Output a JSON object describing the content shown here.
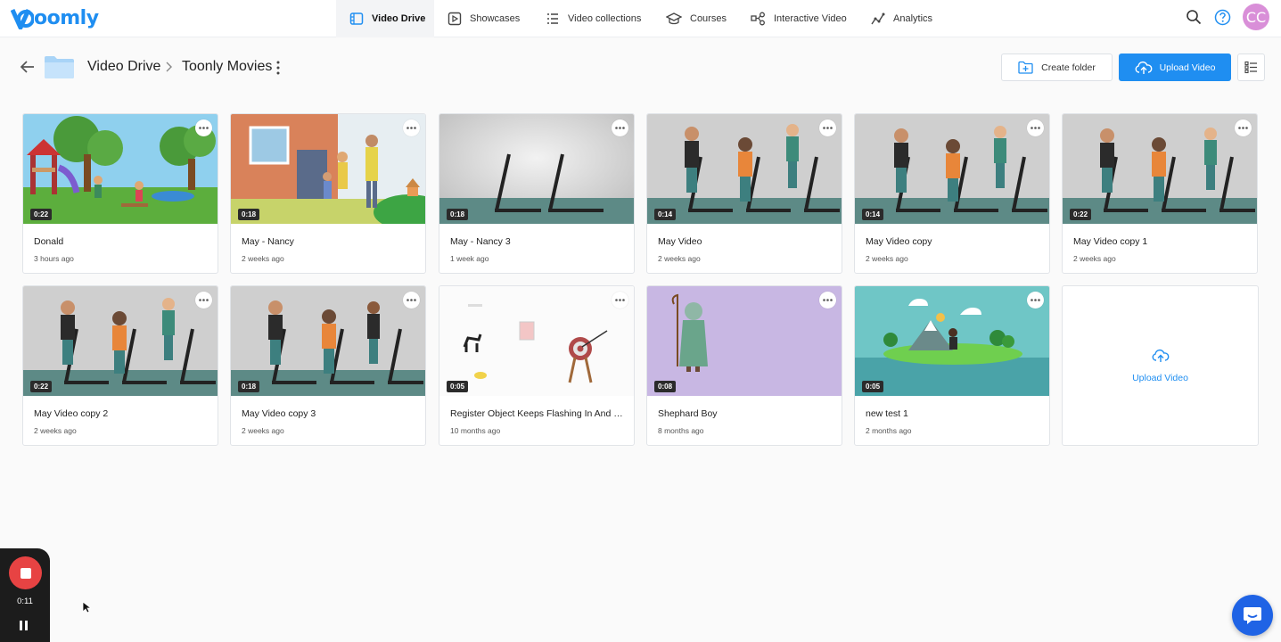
{
  "brand": {
    "logo_text": "oomly",
    "accent": "#1f8ef1"
  },
  "nav": {
    "items": [
      {
        "label": "Video Drive",
        "icon": "video-drive-icon",
        "active": true
      },
      {
        "label": "Showcases",
        "icon": "showcase-icon"
      },
      {
        "label": "Video collections",
        "icon": "collections-icon"
      },
      {
        "label": "Courses",
        "icon": "graduation-cap-icon"
      },
      {
        "label": "Interactive Video",
        "icon": "interactive-icon"
      },
      {
        "label": "Analytics",
        "icon": "analytics-icon"
      }
    ],
    "avatar_initials": "CC"
  },
  "breadcrumb": {
    "root": "Video Drive",
    "current": "Toonly Movies"
  },
  "toolbar": {
    "create_folder": "Create folder",
    "upload_video": "Upload Video"
  },
  "videos": [
    {
      "title": "Donald",
      "time": "3 hours ago",
      "duration": "0:22"
    },
    {
      "title": "May - Nancy",
      "time": "2 weeks ago",
      "duration": "0:18"
    },
    {
      "title": "May - Nancy 3",
      "time": "1 week ago",
      "duration": "0:18"
    },
    {
      "title": "May Video",
      "time": "2 weeks ago",
      "duration": "0:14"
    },
    {
      "title": "May Video copy",
      "time": "2 weeks ago",
      "duration": "0:14"
    },
    {
      "title": "May Video copy 1",
      "time": "2 weeks ago",
      "duration": "0:22"
    },
    {
      "title": "May Video copy 2",
      "time": "2 weeks ago",
      "duration": "0:22"
    },
    {
      "title": "May Video copy 3",
      "time": "2 weeks ago",
      "duration": "0:18"
    },
    {
      "title": "Register Object Keeps Flashing In And Out",
      "time": "10 months ago",
      "duration": "0:05"
    },
    {
      "title": "Shephard Boy",
      "time": "8 months ago",
      "duration": "0:08"
    },
    {
      "title": "new test 1",
      "time": "2 months ago",
      "duration": "0:05"
    }
  ],
  "upload_card": {
    "label": "Upload Video"
  },
  "recorder": {
    "time": "0:11"
  }
}
